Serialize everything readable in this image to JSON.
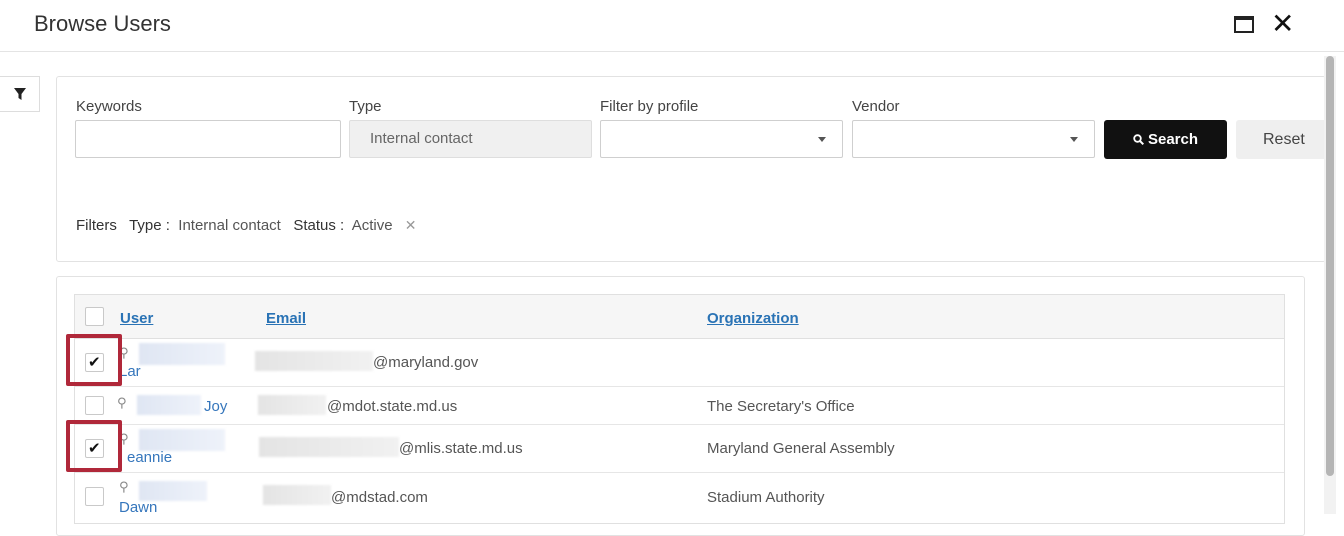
{
  "dialog": {
    "title": "Browse Users"
  },
  "filters": {
    "keywords_label": "Keywords",
    "keywords_value": "",
    "type_label": "Type",
    "type_value": "Internal contact",
    "profile_label": "Filter by profile",
    "profile_value": "",
    "vendor_label": "Vendor",
    "vendor_value": "",
    "search_label": "Search",
    "reset_label": "Reset",
    "active": {
      "heading": "Filters",
      "type_key": "Type :",
      "type_val": "Internal contact",
      "status_key": "Status :",
      "status_val": "Active"
    }
  },
  "table": {
    "columns": [
      "User",
      "Email",
      "Organization"
    ],
    "rows": [
      {
        "checked": true,
        "user": "Lar",
        "email": "@maryland.gov",
        "organization": ""
      },
      {
        "checked": false,
        "user": "Joy",
        "email": "@mdot.state.md.us",
        "organization": "The Secretary's Office"
      },
      {
        "checked": true,
        "user": "eannie",
        "email": "@mlis.state.md.us",
        "organization": "Maryland General Assembly"
      },
      {
        "checked": false,
        "user": "Dawn",
        "email": "@mdstad.com",
        "organization": "Stadium Authority"
      }
    ]
  },
  "colors": {
    "accent_link": "#2a73b5",
    "highlight": "#b0283a",
    "search_bg": "#111111"
  },
  "icons": [
    "maximize-icon",
    "close-icon",
    "filter-icon",
    "search-icon",
    "remove-filter-icon",
    "magnifier-icon",
    "check-icon",
    "dropdown-caret-icon"
  ]
}
